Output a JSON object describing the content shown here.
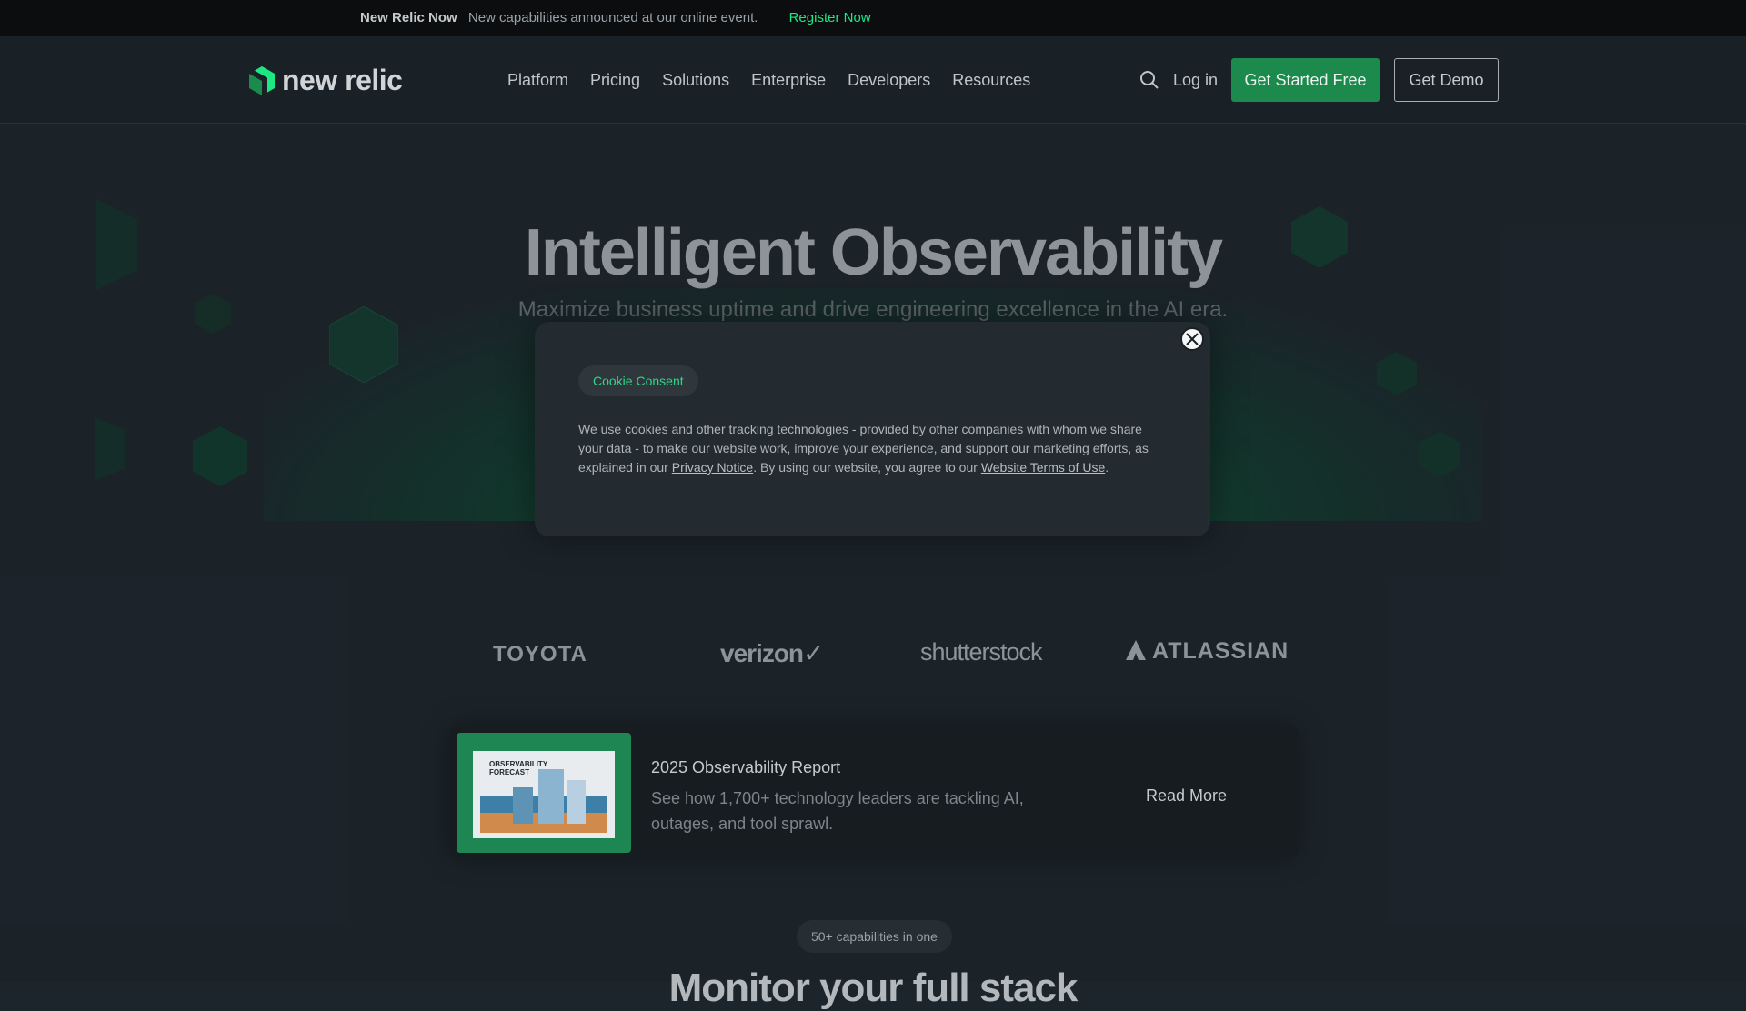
{
  "announcement": {
    "brand": "New Relic Now",
    "text": "New capabilities announced at our online event.",
    "cta": "Register Now"
  },
  "nav": {
    "logo_text": "new relic",
    "items": [
      {
        "label": "Platform"
      },
      {
        "label": "Pricing"
      },
      {
        "label": "Solutions"
      },
      {
        "label": "Enterprise"
      },
      {
        "label": "Developers"
      },
      {
        "label": "Resources"
      }
    ],
    "search_icon": "search-icon",
    "login": "Log in",
    "cta_primary": "Get Started Free",
    "cta_secondary": "Get Demo"
  },
  "hero": {
    "title": "Intelligent Observability",
    "subtitle": "Maximize business uptime and drive engineering excellence in the AI era."
  },
  "cookie_modal": {
    "badge": "Cookie Consent",
    "text_1": "We use cookies and other tracking technologies - provided by other companies with whom we share your data - to make our website work, improve your experience, and support our marketing efforts, as explained in our ",
    "privacy_link": "Privacy Notice",
    "text_2": ". By using our website, you agree to our ",
    "terms_link": "Website Terms of Use",
    "text_3": ".",
    "close_icon": "close-icon"
  },
  "customer_logos": [
    "TOYOTA",
    "verizon✓",
    "shutterstock",
    "ATLASSIAN"
  ],
  "report": {
    "thumb_title": "OBSERVABILITY FORECAST",
    "title": "2025 Observability Report",
    "description": "See how 1,700+ technology leaders are tackling AI, outages, and tool sprawl.",
    "cta": "Read More"
  },
  "capabilities": {
    "badge": "50+ capabilities in one",
    "heading": "Monitor your full stack"
  },
  "colors": {
    "accent": "#1ce783",
    "button_green": "#1c8a4c",
    "background": "#1d252c"
  }
}
